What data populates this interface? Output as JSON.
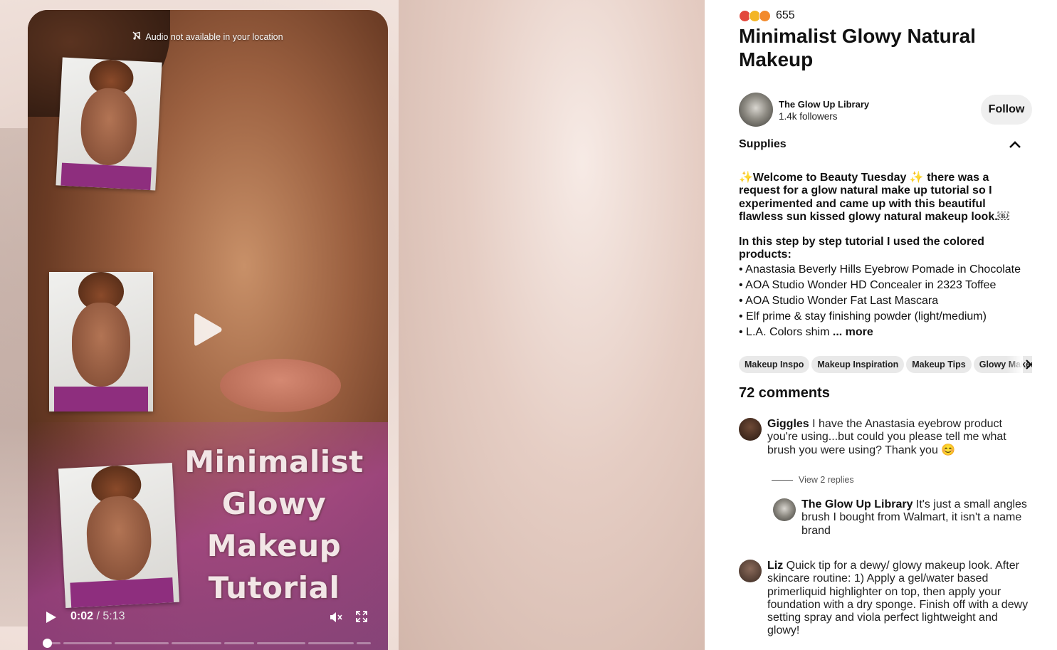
{
  "video": {
    "audio_notice": "Audio not available in your location",
    "overlay_title_lines": [
      "Minimalist",
      "Glowy",
      "Makeup",
      "Tutorial"
    ],
    "current_time": "0:02",
    "total_time": "/ 5:13",
    "progress_fraction": 0.006
  },
  "pin": {
    "reaction_count": "655",
    "title": "Minimalist Glowy Natural Makeup"
  },
  "creator": {
    "name": "The Glow Up Library",
    "followers": "1.4k followers",
    "follow_label": "Follow"
  },
  "supplies_label": "Supplies",
  "description": {
    "lead": "✨Welcome to Beauty Tuesday ✨ there was a request for a glow natural make up tutorial so I experimented and came up with this beautiful flawless sun kissed glowy natural makeup look.￼",
    "heading": "In this step by step tutorial I used the colored products:",
    "items": [
      "Anastasia Beverly Hills Eyebrow Pomade in Chocolate",
      "AOA Studio Wonder HD Concealer in 2323 Toffee",
      "AOA Studio Wonder Fat Last Mascara",
      "Elf prime & stay finishing powder (light/medium)",
      "L.A. Colors shim"
    ],
    "more_label": " ... more"
  },
  "tags": [
    "Makeup Inspo",
    "Makeup Inspiration",
    "Makeup Tips",
    "Glowy Makeup"
  ],
  "comments_header": "72 comments",
  "comments": [
    {
      "author": "Giggles",
      "text": " I have the Anastasia eyebrow product you're using...but could you please tell me what brush you were using? Thank you 😊"
    },
    {
      "author": "The Glow Up Library",
      "text": " It's just a small angles brush I bought from Walmart, it isn't a name brand"
    },
    {
      "author": "Liz",
      "text": " Quick tip for a dewy/ glowy makeup look. After skincare routine: 1) Apply a gel/water based primerliquid highlighter on top, then apply your foundation with a dry sponge. Finish off with a dewy setting spray and viola perfect lightweight and glowy!"
    }
  ],
  "view_replies_label": "View 2 replies",
  "colors": {
    "follow_bg": "#efefef",
    "tag_bg": "#e9e9e9"
  },
  "icons": [
    "music-off-icon",
    "play-icon",
    "mute-icon",
    "fullscreen-icon",
    "chevron-up-icon",
    "chevron-right-icon"
  ]
}
